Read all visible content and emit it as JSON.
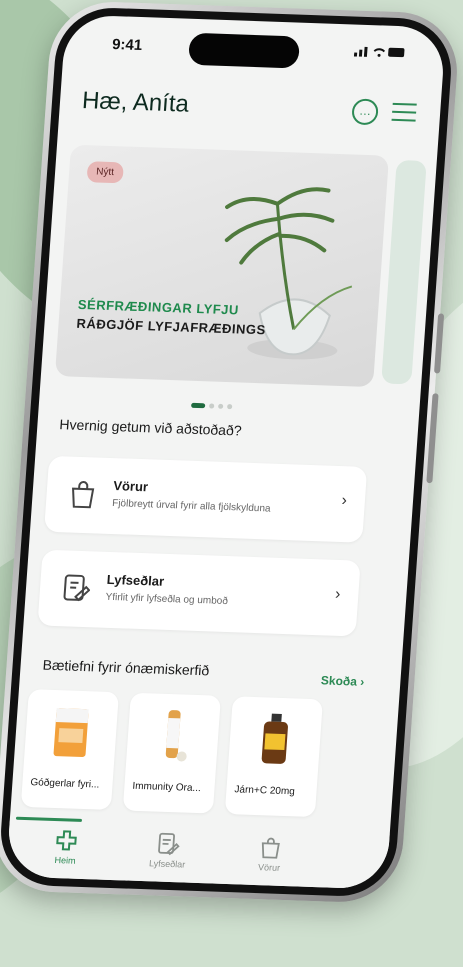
{
  "status_bar": {
    "time": "9:41"
  },
  "header": {
    "greeting": "Hæ, Aníta"
  },
  "hero": {
    "badge": "Nýtt",
    "line1": "SÉRFRÆÐINGAR LYFJU",
    "line2": "RÁÐGJÖF LYFJAFRÆÐINGS"
  },
  "help_section": {
    "title": "Hvernig getum við aðstoðað?",
    "cards": [
      {
        "title": "Vörur",
        "subtitle": "Fjölbreytt úrval fyrir alla fjölskylduna"
      },
      {
        "title": "Lyfseðlar",
        "subtitle": "Yfirlit yfir lyfseðla og umboð"
      }
    ]
  },
  "products_section": {
    "title": "Bætiefni fyrir ónæmiskerfið",
    "see_all": "Skoða",
    "items": [
      {
        "name": "Góðgerlar fyri..."
      },
      {
        "name": "Immunity Ora..."
      },
      {
        "name": "Járn+C 20mg"
      }
    ]
  },
  "tabbar": {
    "tabs": [
      {
        "label": "Heim"
      },
      {
        "label": "Lyfseðlar"
      },
      {
        "label": "Vörur"
      }
    ]
  },
  "colors": {
    "accent": "#2d8a55",
    "badge_bg": "#e7b7b6",
    "background": "#cfe0cf"
  }
}
